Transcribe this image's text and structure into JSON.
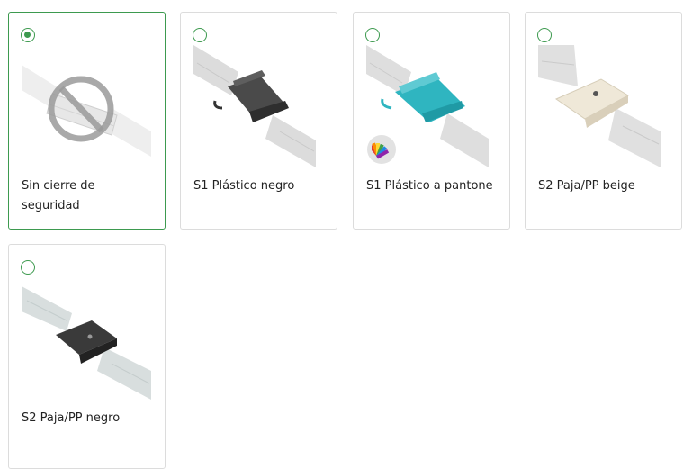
{
  "options": [
    {
      "label": "Sin cierre de seguridad",
      "selected": true,
      "icon": "no-symbol-icon"
    },
    {
      "label": "S1 Plástico negro",
      "selected": false,
      "clip_color": "#3d3d3d"
    },
    {
      "label": "S1 Plástico a pantone",
      "selected": false,
      "clip_color": "#2db4bf",
      "badge": "pantone-fan-icon"
    },
    {
      "label": "S2 Paja/PP beige",
      "selected": false,
      "clip_color": "#ece4d4"
    },
    {
      "label": "S2 Paja/PP negro",
      "selected": false,
      "clip_color": "#333333"
    }
  ],
  "colors": {
    "accent": "#3d9a4f",
    "border": "#dcdcdc"
  }
}
